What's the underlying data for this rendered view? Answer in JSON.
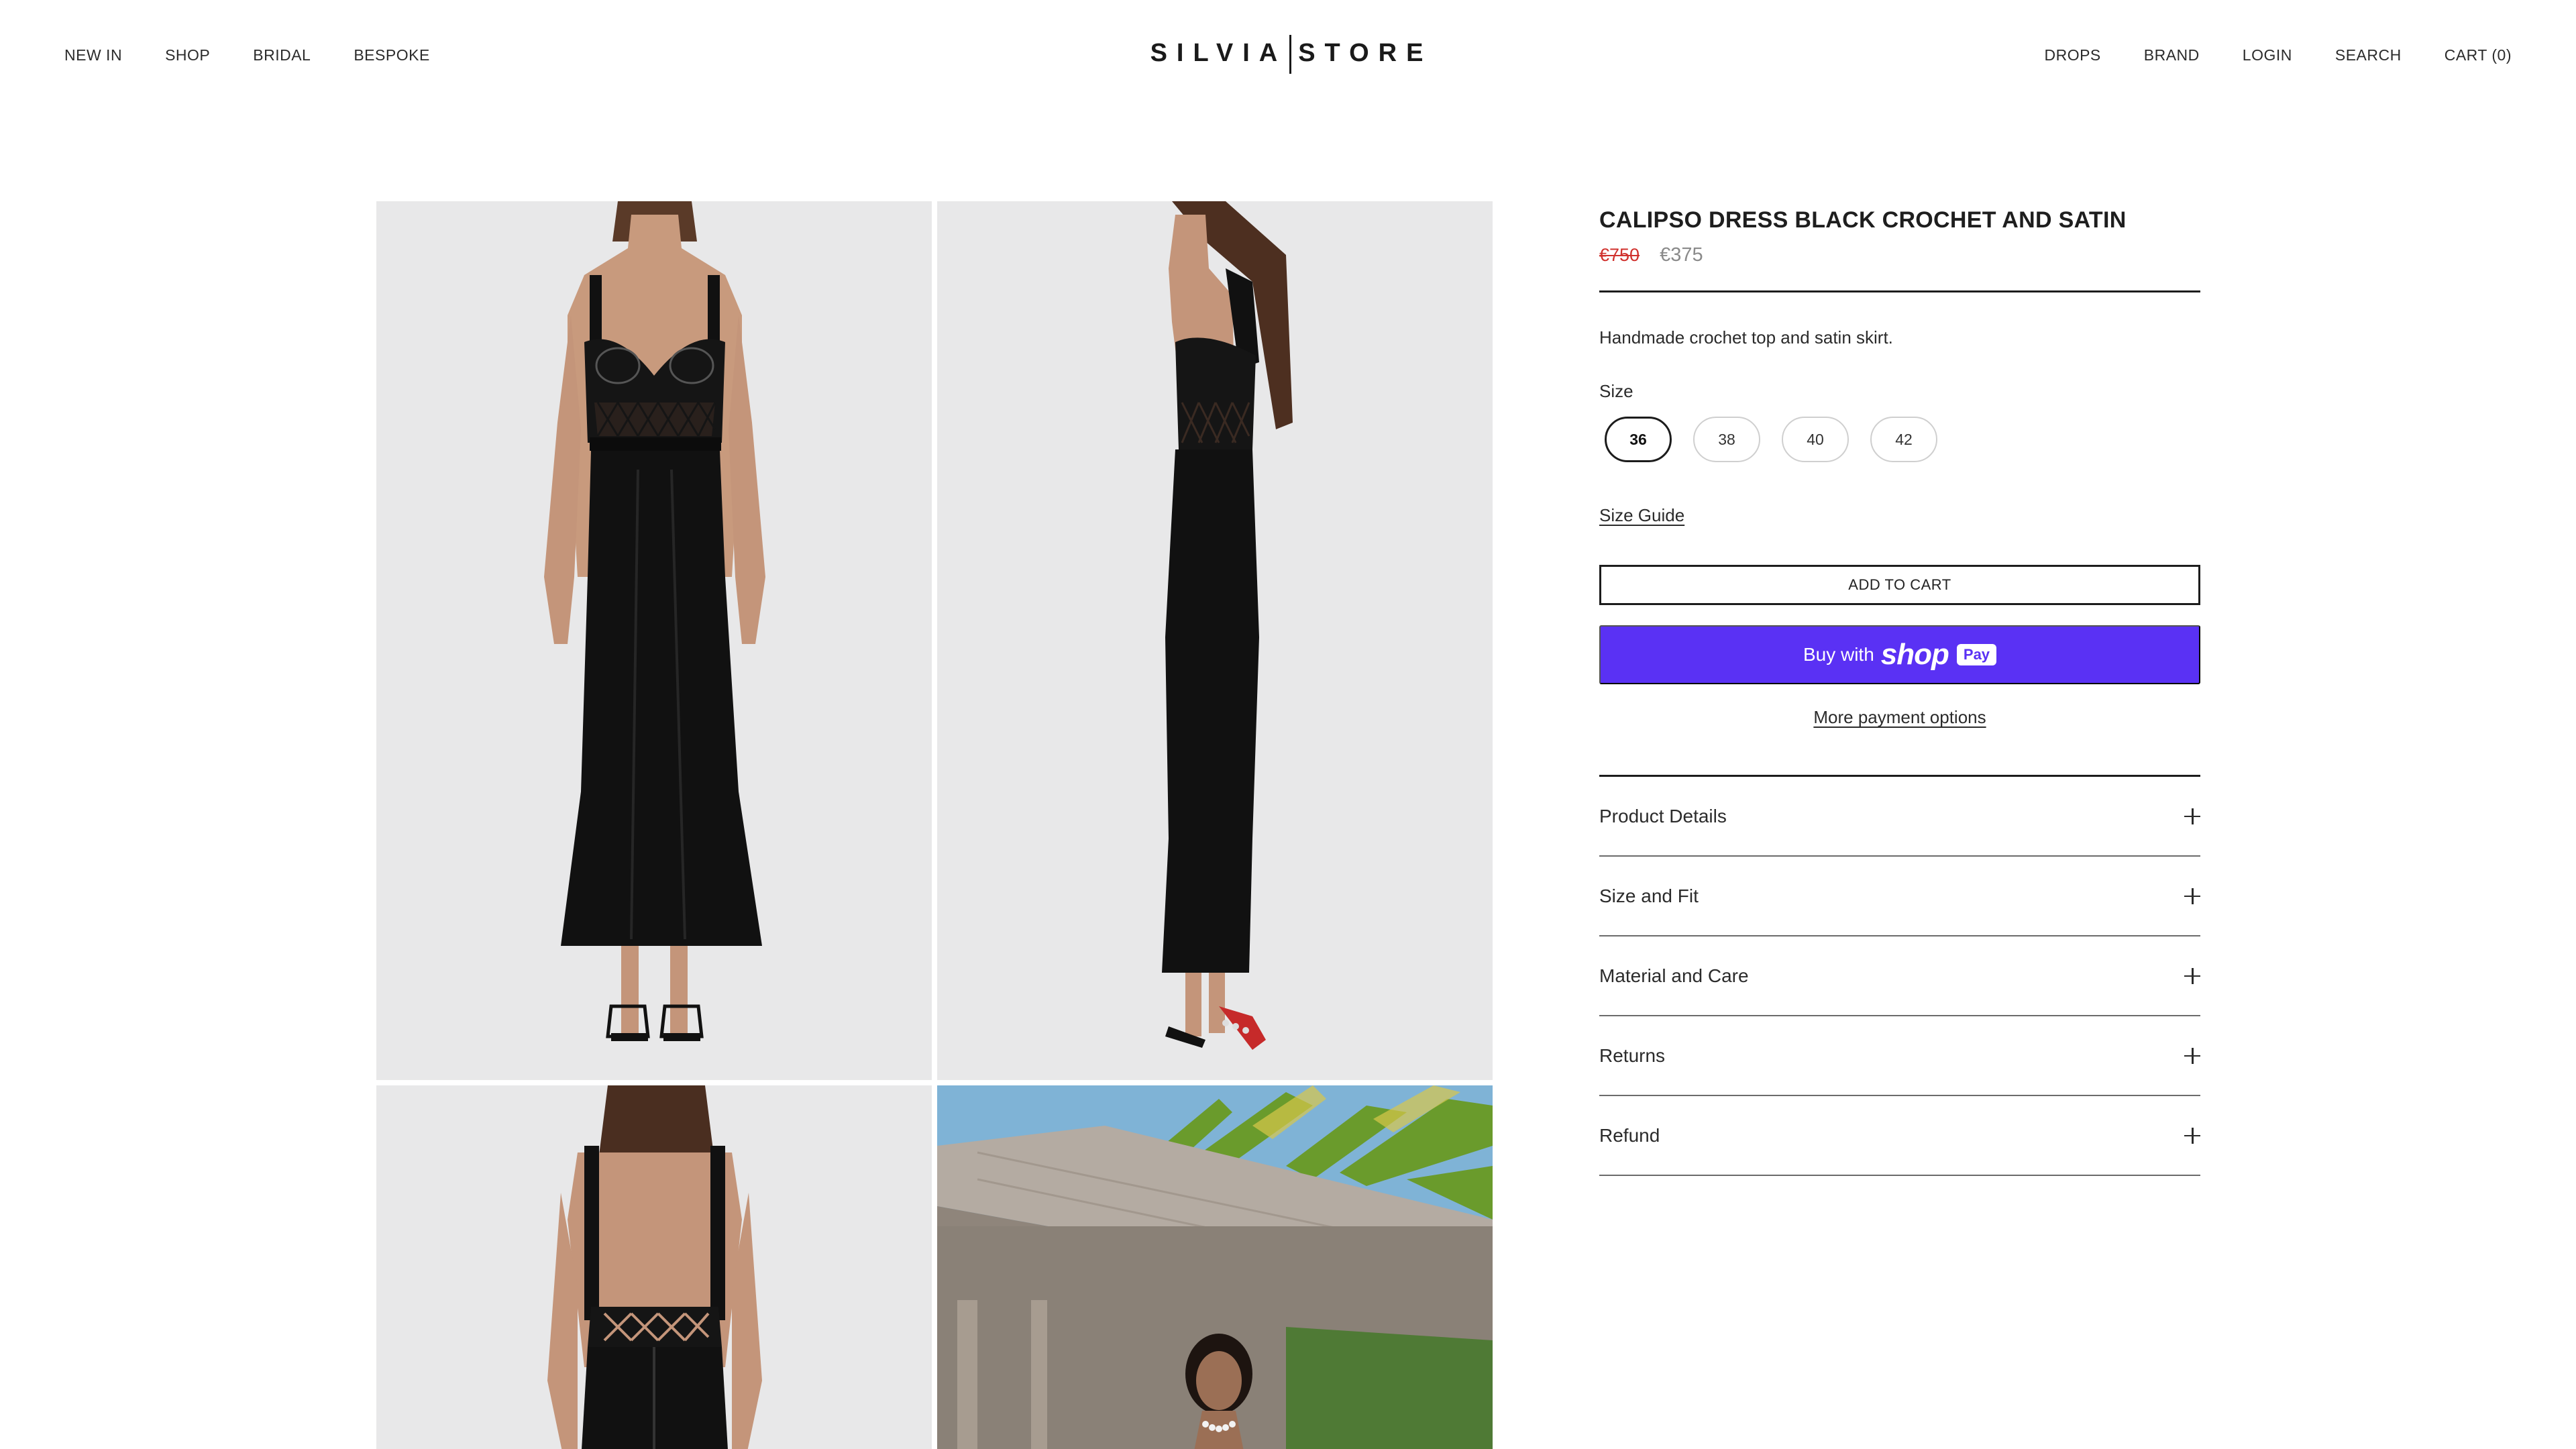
{
  "header": {
    "logo": {
      "left": "SILVIA",
      "right": "STORE"
    },
    "nav_left": [
      "NEW IN",
      "SHOP",
      "BRIDAL",
      "BESPOKE"
    ],
    "nav_right": [
      "DROPS",
      "BRAND",
      "LOGIN",
      "SEARCH",
      "CART (0)"
    ]
  },
  "product": {
    "title": "CALIPSO DRESS BLACK CROCHET AND SATIN",
    "price_old": "€750",
    "price_new": "€375",
    "description": "Handmade crochet top and satin skirt.",
    "size_label": "Size",
    "sizes": [
      "36",
      "38",
      "40",
      "42"
    ],
    "selected_size": "36",
    "size_guide": "Size Guide",
    "add_to_cart": "ADD TO CART",
    "shop_pay": {
      "buy_with": "Buy with",
      "shop": "shop",
      "pay": "Pay"
    },
    "more_payment": "More payment options",
    "accordion": [
      "Product Details",
      "Size and Fit",
      "Material and Care",
      "Returns",
      "Refund"
    ]
  },
  "colors": {
    "shop_pay": "#5a31f4",
    "sale_price": "#d0312d",
    "photo_bg": "#e9e9ea"
  },
  "gallery": {
    "images": [
      "dress-front-photo",
      "dress-side-photo",
      "dress-back-photo",
      "outdoor-model-photo"
    ]
  }
}
